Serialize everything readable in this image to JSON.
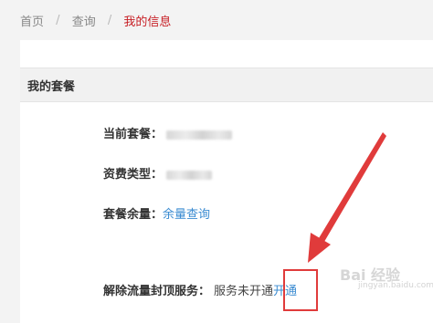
{
  "breadcrumb": {
    "items": [
      "首页",
      "查询",
      "我的信息"
    ],
    "separator": "/"
  },
  "card": {
    "title": "我的套餐"
  },
  "fields": {
    "current_plan_label": "当前套餐：",
    "fee_type_label": "资费类型：",
    "balance_label": "套餐余量：",
    "balance_link": "余量查询",
    "cap_label": "解除流量封顶服务：",
    "cap_status": "服务未开通",
    "cap_action": "开通"
  },
  "watermark": {
    "text": "Bai 经验",
    "sub": "jingyan.baidu.com"
  },
  "colors": {
    "breadcrumb_active": "#c71e24",
    "link": "#3a8bd1",
    "annotation_red": "#e03b3b"
  }
}
